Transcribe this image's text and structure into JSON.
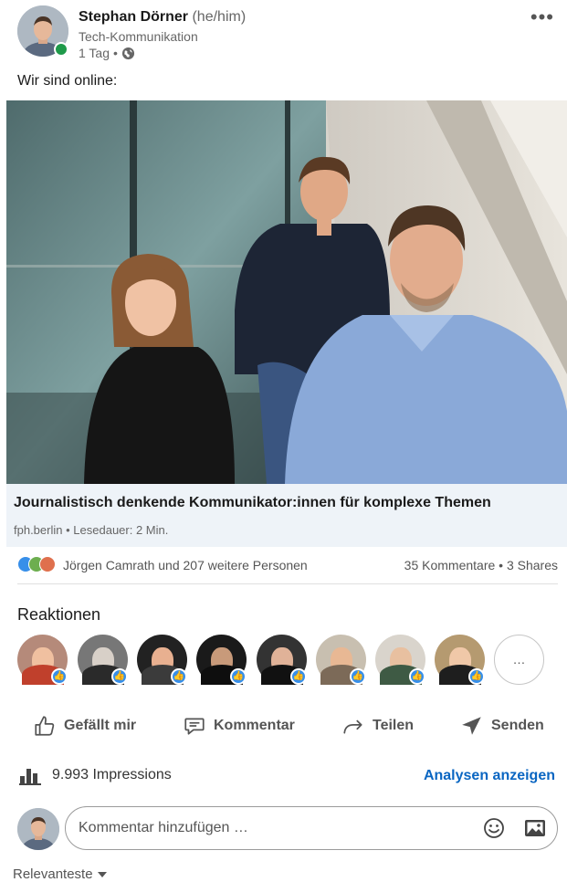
{
  "post": {
    "author": {
      "name": "Stephan Dörner",
      "pronouns": "(he/him)",
      "subtitle": "Tech-Kommunikation"
    },
    "meta": {
      "time": "1 Tag",
      "separator": "•",
      "visibility_icon": "globe-icon"
    },
    "more_label": "•••",
    "text": "Wir sind online:"
  },
  "link_preview": {
    "title": "Journalistisch denkende Kommunikator:innen für komplexe Themen",
    "source": "fph.berlin",
    "separator": "•",
    "read_time": "Lesedauer: 2 Min."
  },
  "social": {
    "reactors": "Jörgen Camrath und 207 weitere Personen",
    "comments_shares": "35 Kommentare • 3 Shares"
  },
  "reactions": {
    "title": "Reaktionen",
    "more_label": "…"
  },
  "actions": {
    "like": "Gefällt mir",
    "comment": "Kommentar",
    "share": "Teilen",
    "send": "Senden"
  },
  "impressions": {
    "label": "9.993 Impressions",
    "analytics_link": "Analysen anzeigen"
  },
  "comment_box": {
    "placeholder": "Kommentar hinzufügen …"
  },
  "sort": {
    "label": "Relevanteste"
  },
  "colors": {
    "online": "#1f9a4a",
    "link_accent": "#0a66c2",
    "like_badge": "#378fe9",
    "link_box_bg": "#eef3f8"
  }
}
